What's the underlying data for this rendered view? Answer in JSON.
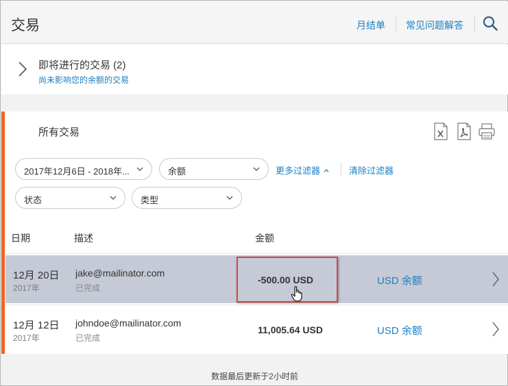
{
  "header": {
    "title": "交易",
    "links": {
      "statement": "月结单",
      "faq": "常见问题解答"
    },
    "search_icon": "search-icon"
  },
  "pending": {
    "title": "即将进行的交易 (2)",
    "subtitle": "尚未影响您的余额的交易"
  },
  "all_transactions": {
    "title": "所有交易",
    "export_icons": [
      "excel-export-icon",
      "pdf-export-icon",
      "print-icon"
    ],
    "filters": {
      "date_range": "2017年12月6日 - 2018年...",
      "amount": "余额",
      "status": "状态",
      "type": "类型",
      "more_filters": "更多过滤器",
      "clear_filters": "清除过滤器"
    },
    "columns": {
      "date": "日期",
      "description": "描述",
      "amount": "金额"
    },
    "rows": [
      {
        "date": "12月 20日",
        "year": "2017年",
        "description": "jake@mailinator.com",
        "status": "已完成",
        "amount": "-500.00 USD",
        "balance": "USD 余额",
        "selected": true
      },
      {
        "date": "12月 12日",
        "year": "2017年",
        "description": "johndoe@mailinator.com",
        "status": "已完成",
        "amount": "11,005.64 USD",
        "balance": "USD 余额",
        "selected": false
      }
    ]
  },
  "footer": {
    "note": "数据最后更新于2小时前"
  },
  "colors": {
    "accent": "#f26322",
    "link": "#1b7fc4",
    "selected_row": "#c5cad6",
    "highlight": "#d9443a"
  }
}
